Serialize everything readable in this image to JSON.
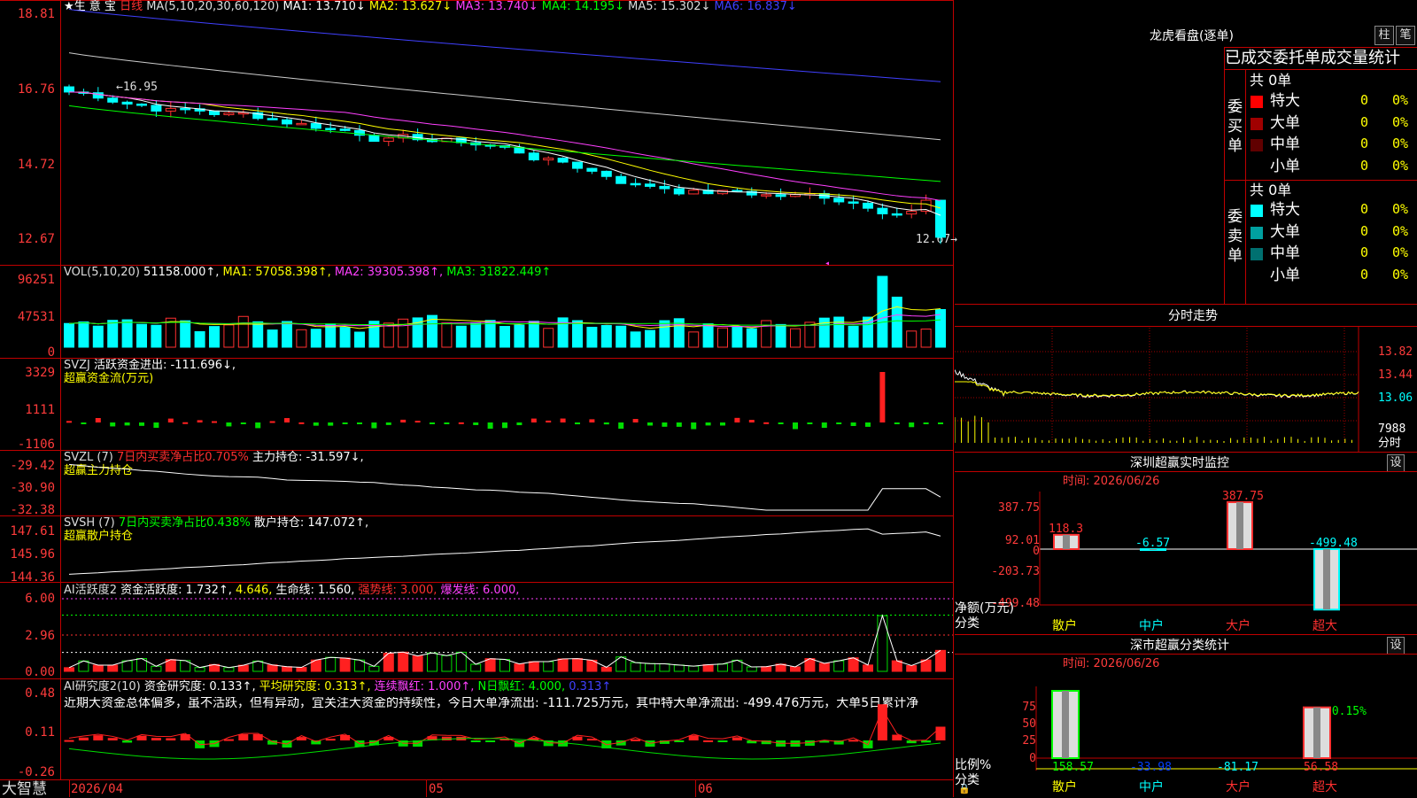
{
  "main": {
    "y_ticks": [
      "18.81",
      "16.76",
      "14.72",
      "12.67"
    ],
    "title_items": [
      {
        "text": "★生 意 宝",
        "color": "#ffffff"
      },
      {
        "text": "日线",
        "color": "#ff3030"
      },
      {
        "text": "MA(5,10,20,30,60,120)",
        "color": "#dddddd"
      },
      {
        "text": "MA1: 13.710↓",
        "color": "#ffffff"
      },
      {
        "text": "MA2: 13.627↓",
        "color": "#ffff00"
      },
      {
        "text": "MA3: 13.740↓",
        "color": "#ff40ff"
      },
      {
        "text": "MA4: 14.195↓",
        "color": "#00ff00"
      },
      {
        "text": "MA5: 15.302↓",
        "color": "#dddddd"
      },
      {
        "text": "MA6: 16.837↓",
        "color": "#4040ff"
      }
    ],
    "high_label": "16.95",
    "low_label": "12.67→",
    "marker_char": "◂"
  },
  "vol": {
    "y_ticks": [
      "96251",
      "47531",
      "0"
    ],
    "title_items": [
      {
        "text": "VOL(5,10,20)",
        "color": "#dddddd"
      },
      {
        "text": "51158.000↑,",
        "color": "#ffffff"
      },
      {
        "text": "MA1: 57058.398↑,",
        "color": "#ffff00"
      },
      {
        "text": "MA2: 39305.398↑,",
        "color": "#ff40ff"
      },
      {
        "text": "MA3: 31822.449↑",
        "color": "#00ff00"
      }
    ]
  },
  "svzj": {
    "y_ticks": [
      "3329",
      "1111",
      "-1106"
    ],
    "title_items": [
      {
        "text": "SVZJ",
        "color": "#dddddd"
      },
      {
        "text": "活跃资金进出: -111.696↓,",
        "color": "#ffffff"
      }
    ],
    "subtitle": "超赢资金流(万元)"
  },
  "svzl": {
    "y_ticks": [
      "-29.42",
      "-30.90",
      "-32.38"
    ],
    "title_items": [
      {
        "text": "SVZL (7)",
        "color": "#dddddd"
      },
      {
        "text": "7日内买卖净占比0.705%",
        "color": "#ff3030"
      },
      {
        "text": "主力持仓: -31.597↓,",
        "color": "#ffffff"
      }
    ],
    "subtitle": "超赢主力持仓"
  },
  "svsh": {
    "y_ticks": [
      "147.61",
      "145.96",
      "144.36"
    ],
    "title_items": [
      {
        "text": "SVSH (7)",
        "color": "#dddddd"
      },
      {
        "text": "7日内买卖净占比0.438%",
        "color": "#00ff00"
      },
      {
        "text": "散户持仓: 147.072↑,",
        "color": "#ffffff"
      }
    ],
    "subtitle": "超赢散户持仓"
  },
  "ai1": {
    "y_ticks": [
      "6.00",
      "2.96",
      "0.00"
    ],
    "title_items": [
      {
        "text": "AI活跃度2",
        "color": "#dddddd"
      },
      {
        "text": "资金活跃度: 1.732↑,",
        "color": "#ffffff"
      },
      {
        "text": "4.646,",
        "color": "#ffff00"
      },
      {
        "text": "生命线: 1.560,",
        "color": "#ffffff"
      },
      {
        "text": "强势线: 3.000,",
        "color": "#ff3030"
      },
      {
        "text": "爆发线: 6.000,",
        "color": "#ff40ff"
      }
    ]
  },
  "ai2": {
    "y_ticks": [
      "0.48",
      "0.11",
      "-0.26"
    ],
    "title_items": [
      {
        "text": "AI研究度2(10)",
        "color": "#dddddd"
      },
      {
        "text": "资金研究度: 0.133↑,",
        "color": "#ffffff"
      },
      {
        "text": "平均研究度: 0.313↑,",
        "color": "#ffff00"
      },
      {
        "text": "连续飘红: 1.000↑,",
        "color": "#ff40ff"
      },
      {
        "text": "N日飘红: 4.000,",
        "color": "#00ff00"
      },
      {
        "text": "0.313↑",
        "color": "#4040ff"
      }
    ],
    "comment": "近期大资金总体偏多，虽不活跃，但有异动，宜关注大资金的持续性，今日大单净流出: -111.725万元，其中特大单净流出: -499.476万元，大单5日累计净"
  },
  "xaxis": {
    "labels": [
      "2026/04",
      "05",
      "06"
    ],
    "brand": "大智慧"
  },
  "right": {
    "lhb": {
      "title": "龙虎看盘(逐单)",
      "btn_col": "柱",
      "btn_pen": "笔",
      "subtitle": "已成交委托单成交量统计",
      "buy": {
        "side_label": "委买单",
        "total": "共 0单",
        "rows": [
          {
            "name": "特大",
            "count": "0",
            "pct": "0%",
            "color": "#ff0000"
          },
          {
            "name": "大单",
            "count": "0",
            "pct": "0%",
            "color": "#a00000"
          },
          {
            "name": "中单",
            "count": "0",
            "pct": "0%",
            "color": "#600000"
          },
          {
            "name": "小单",
            "count": "0",
            "pct": "0%",
            "color": "#000000"
          }
        ]
      },
      "sell": {
        "side_label": "委卖单",
        "total": "共 0单",
        "rows": [
          {
            "name": "特大",
            "count": "0",
            "pct": "0%",
            "color": "#00ffff"
          },
          {
            "name": "大单",
            "count": "0",
            "pct": "0%",
            "color": "#00a0a0"
          },
          {
            "name": "中单",
            "count": "0",
            "pct": "0%",
            "color": "#007070"
          },
          {
            "name": "小单",
            "count": "0",
            "pct": "0%",
            "color": "#000000"
          }
        ]
      }
    },
    "intraday": {
      "title": "分时走势",
      "y_ticks": [
        "13.82",
        "13.44",
        "13.06"
      ],
      "vol_tick": "7988",
      "vol_unit": "分时"
    },
    "sz_monitor": {
      "title": "深圳超赢实时监控",
      "set_btn": "设",
      "time": "时间: 2026/06/26",
      "y_ticks": [
        "387.75",
        "92.01",
        "0",
        "-203.73",
        "-499.48"
      ],
      "unit1": "净额(万元)",
      "unit2": "分类",
      "bars": [
        {
          "category": "散户",
          "value": 118.3,
          "label": "118.3"
        },
        {
          "category": "中户",
          "value": -6.57,
          "label": "-6.57"
        },
        {
          "category": "大户",
          "value": 387.75,
          "label": "387.75"
        },
        {
          "category": "超大",
          "value": -499.48,
          "label": "-499.48"
        }
      ]
    },
    "sz_stats": {
      "title": "深市超赢分类统计",
      "set_btn": "设",
      "time": "时间: 2026/06/26",
      "y_ticks": [
        "75",
        "50",
        "25",
        "0"
      ],
      "unit1": "比例%",
      "unit2": "分类",
      "top_label": "-0.15%",
      "bars": [
        {
          "category": "散户",
          "value": 158.57,
          "label": "158.57"
        },
        {
          "category": "中户",
          "value": -33.98,
          "label": "-33.98"
        },
        {
          "category": "大户",
          "value": -81.17,
          "label": "-81.17"
        },
        {
          "category": "超大",
          "value": 56.58,
          "label": "56.58"
        }
      ]
    }
  },
  "chart_data": [
    {
      "type": "candlestick",
      "title": "生意宝 日线",
      "ylim": [
        12.67,
        18.81
      ],
      "note": "daily candles with MA(5,10,20,30,60,120)",
      "ma_last": {
        "MA1": 13.71,
        "MA2": 13.627,
        "MA3": 13.74,
        "MA4": 14.195,
        "MA5": 15.302,
        "MA6": 16.837
      },
      "high_label": 16.95,
      "low_label": 12.67
    },
    {
      "type": "bar",
      "title": "VOL(5,10,20)",
      "ylim": [
        0,
        96251
      ],
      "last": 51158.0,
      "ma": {
        "MA1": 57058.398,
        "MA2": 39305.398,
        "MA3": 31822.449
      }
    },
    {
      "type": "bar",
      "title": "SVZJ",
      "ylim": [
        -1106,
        3329
      ],
      "last": -111.696
    },
    {
      "type": "line",
      "title": "SVZL (7)",
      "ylim": [
        -32.38,
        -29.42
      ],
      "last": -31.597
    },
    {
      "type": "line",
      "title": "SVSH (7)",
      "ylim": [
        144.36,
        147.61
      ],
      "last": 147.072
    },
    {
      "type": "bar",
      "title": "AI活跃度2",
      "ylim": [
        0,
        6.0
      ],
      "values": {
        "资金活跃度": 1.732,
        "生命线": 1.56,
        "强势线": 3.0,
        "爆发线": 6.0
      }
    },
    {
      "type": "bar",
      "title": "AI研究度2(10)",
      "ylim": [
        -0.26,
        0.48
      ],
      "values": {
        "资金研究度": 0.133,
        "平均研究度": 0.313,
        "连续飘红": 1.0,
        "N日飘红": 4.0
      }
    },
    {
      "type": "bar",
      "title": "深圳超赢实时监控",
      "categories": [
        "散户",
        "中户",
        "大户",
        "超大"
      ],
      "values": [
        118.3,
        -6.57,
        387.75,
        -499.48
      ],
      "ylabel": "净额(万元)"
    },
    {
      "type": "bar",
      "title": "深市超赢分类统计",
      "categories": [
        "散户",
        "中户",
        "大户",
        "超大"
      ],
      "values": [
        158.57,
        -33.98,
        -81.17,
        56.58
      ],
      "ylabel": "比例%"
    }
  ]
}
